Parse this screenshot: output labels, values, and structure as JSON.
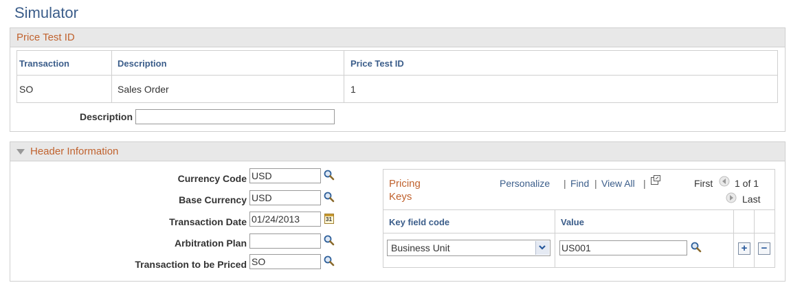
{
  "page": {
    "title": "Simulator"
  },
  "price_test": {
    "section_title": "Price Test ID",
    "columns": [
      "Transaction",
      "Description",
      "Price Test ID"
    ],
    "row": {
      "transaction": "SO",
      "description": "Sales Order",
      "price_test_id": "1"
    },
    "description_label": "Description",
    "description_value": ""
  },
  "header_info": {
    "section_title": "Header Information",
    "fields": [
      {
        "label": "Currency Code",
        "value": "USD",
        "icon": "search-icon"
      },
      {
        "label": "Base Currency",
        "value": "USD",
        "icon": "search-icon"
      },
      {
        "label": "Transaction Date",
        "value": "01/24/2013",
        "icon": "calendar-icon"
      },
      {
        "label": "Arbitration Plan",
        "value": "",
        "icon": "search-icon"
      },
      {
        "label": "Transaction to be Priced",
        "value": "SO",
        "icon": "search-icon"
      }
    ],
    "calendar_glyph": "31"
  },
  "pricing_keys": {
    "title_line1": "Pricing",
    "title_line2": "Keys",
    "personalize": "Personalize",
    "find": "Find",
    "view_all": "View All",
    "separator": "|",
    "first": "First",
    "page_info": "1 of 1",
    "last": "Last",
    "columns": [
      "Key field code",
      "Value"
    ],
    "row": {
      "key_field_code": "Business Unit",
      "value": "US001"
    },
    "add_label": "+",
    "remove_label": "−"
  },
  "colors": {
    "title": "#3b5d8a",
    "section_title": "#c0622e",
    "header_bg": "#e8e8e8",
    "link": "#3b5d8a"
  }
}
